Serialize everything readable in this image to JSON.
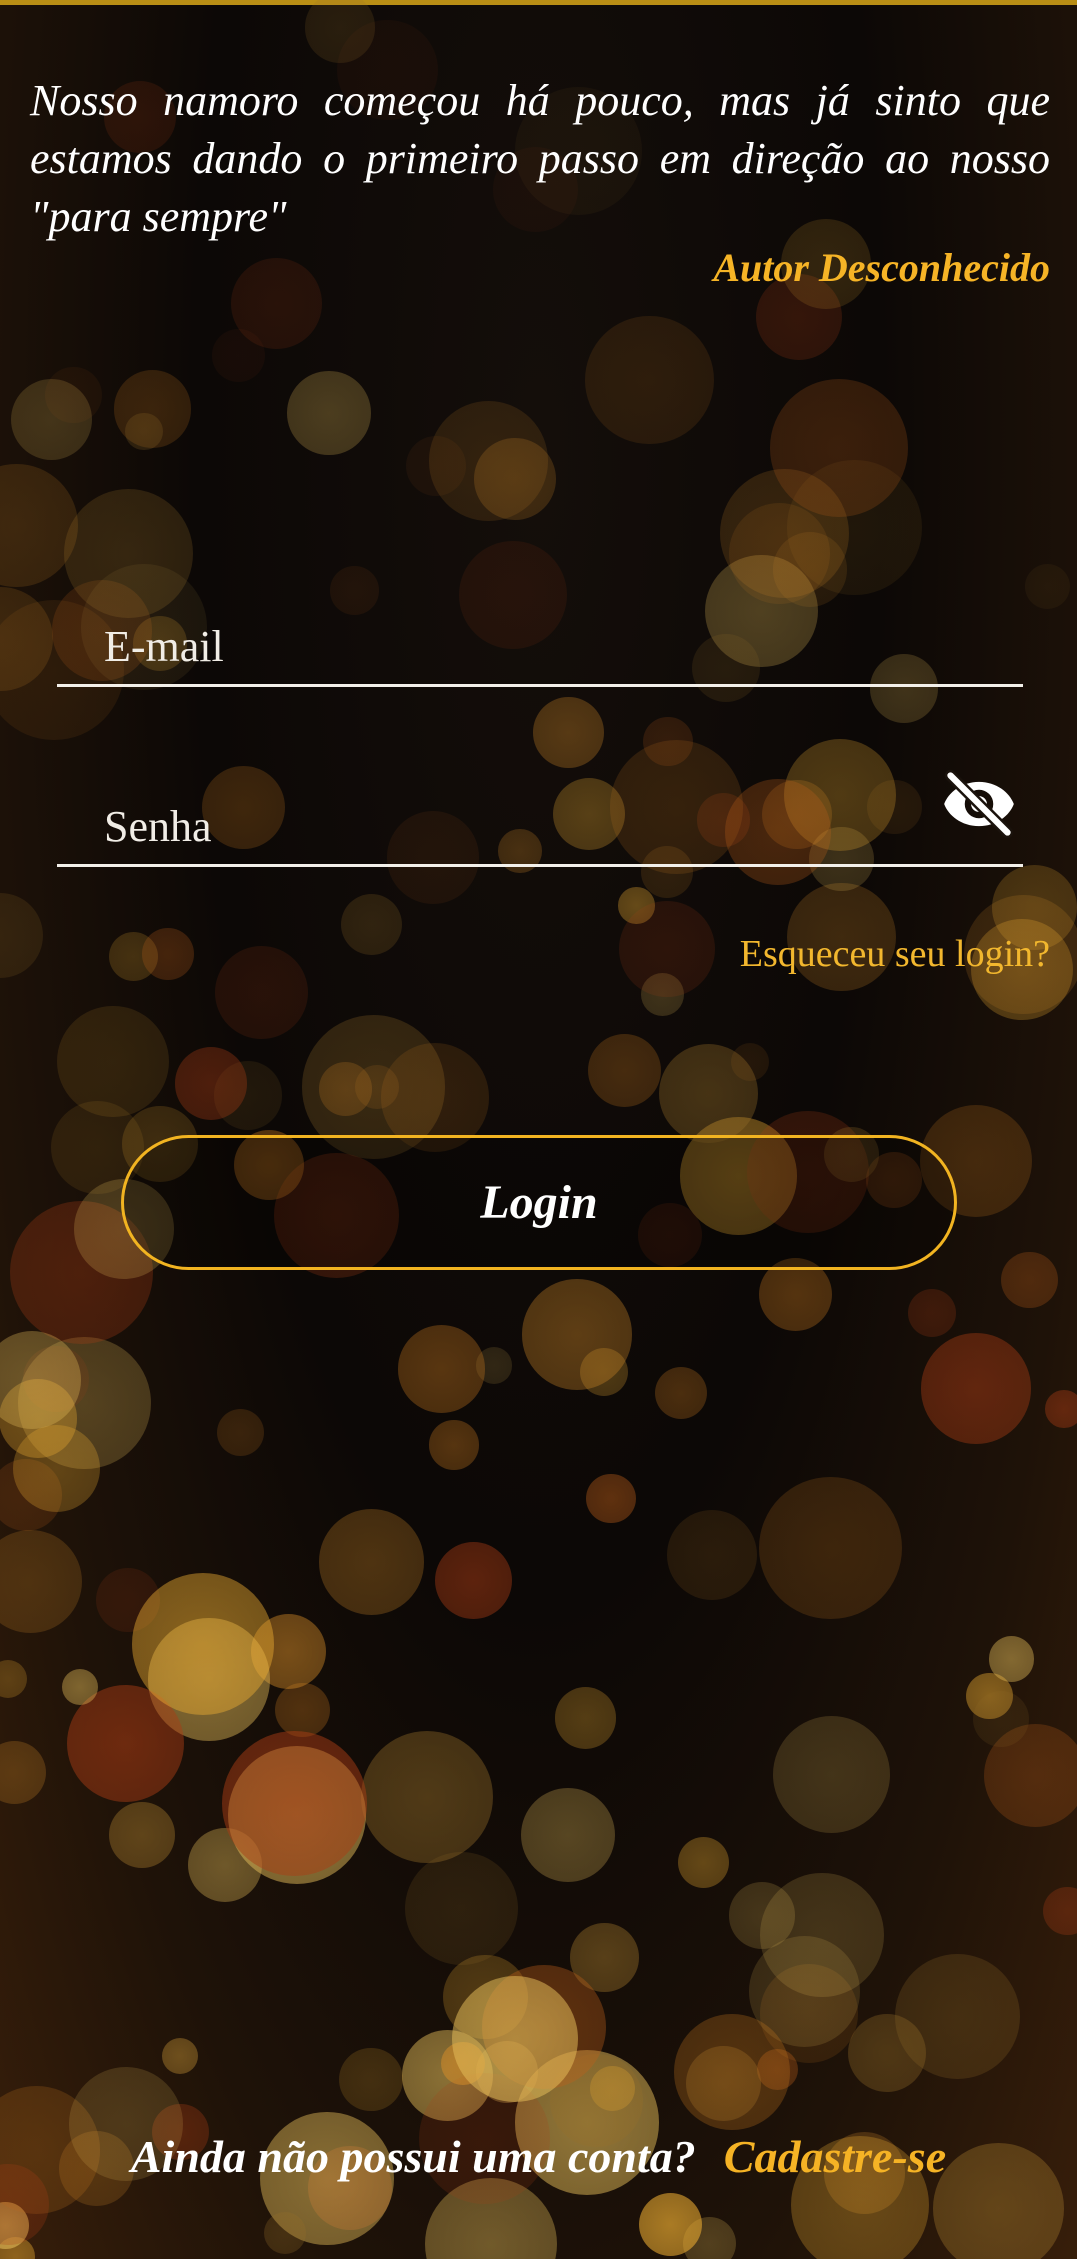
{
  "quote": {
    "text": "Nosso namoro começou há pouco, mas já sinto que estamos dando o primeiro passo em direção ao nosso \"para sempre\"",
    "author": "Autor Desconhecido"
  },
  "login_form": {
    "email_placeholder": "E-mail",
    "password_placeholder": "Senha",
    "toggle_password_icon": "eye-off-icon",
    "forgot_link": "Esqueceu seu login?",
    "login_button": "Login"
  },
  "signup": {
    "prompt": "Ainda não possui uma conta?",
    "link": "Cadastre-se"
  },
  "colors": {
    "accent": "#f5b325",
    "button_border": "#f2b421",
    "top_line": "#b98e15",
    "background": "#0d0805"
  }
}
